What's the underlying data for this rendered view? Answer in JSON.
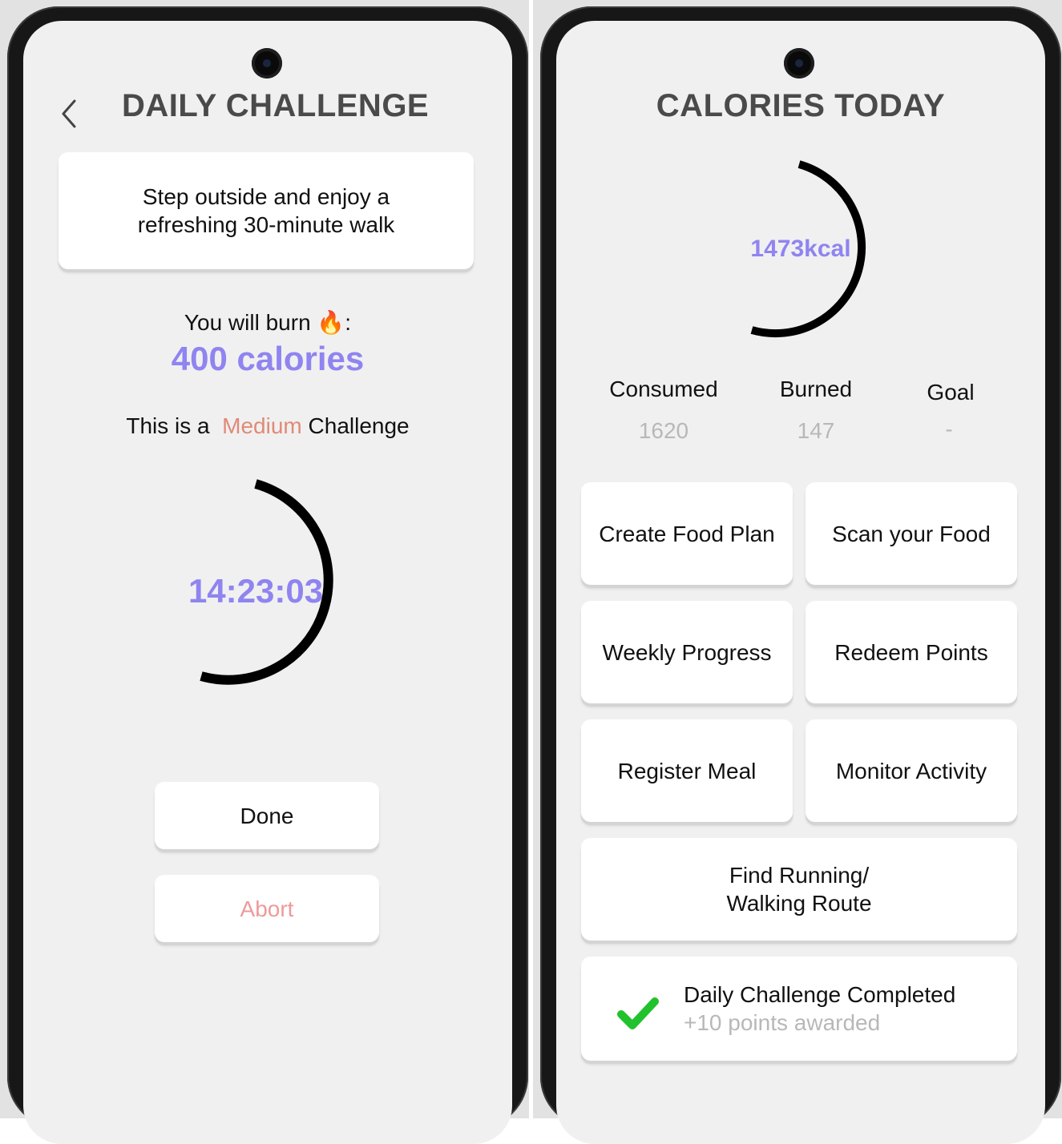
{
  "left": {
    "title": "DAILY CHALLENGE",
    "challenge_text_line1": "Step outside and enjoy a",
    "challenge_text_line2": "refreshing 30-minute walk",
    "burn_prefix": "You will burn",
    "burn_emoji": "🔥",
    "burn_suffix": ":",
    "calories": "400 calories",
    "difficulty_prefix": "This is a",
    "difficulty": "Medium",
    "difficulty_suffix": "Challenge",
    "timer": "14:23:03",
    "done_label": "Done",
    "abort_label": "Abort",
    "icons": {
      "back": "chevron-left-icon",
      "timer_ring": "progress-ring-icon"
    }
  },
  "right": {
    "title": "CALORIES TODAY",
    "kcal": "1473kcal",
    "stats": [
      {
        "label": "Consumed",
        "value": "1620"
      },
      {
        "label": "Burned",
        "value": "147"
      },
      {
        "label": "Goal",
        "value": "-"
      }
    ],
    "actions": {
      "create_food_plan": "Create Food Plan",
      "scan_food": "Scan your Food",
      "weekly_progress": "Weekly Progress",
      "redeem_points": "Redeem Points",
      "register_meal": "Register Meal",
      "monitor_activity": "Monitor Activity",
      "find_route_line1": "Find Running/",
      "find_route_line2": "Walking Route"
    },
    "challenge_completed": "Daily Challenge Completed",
    "points_awarded": "+10 points awarded",
    "icons": {
      "check": "checkmark-icon",
      "kcal_ring": "progress-ring-icon"
    }
  },
  "colors": {
    "accent_purple": "#8f84f0",
    "medium_orange": "#e08a78",
    "abort_red": "#ee9a9a",
    "check_green": "#22c22e",
    "muted_gray": "#b8b8b8"
  }
}
